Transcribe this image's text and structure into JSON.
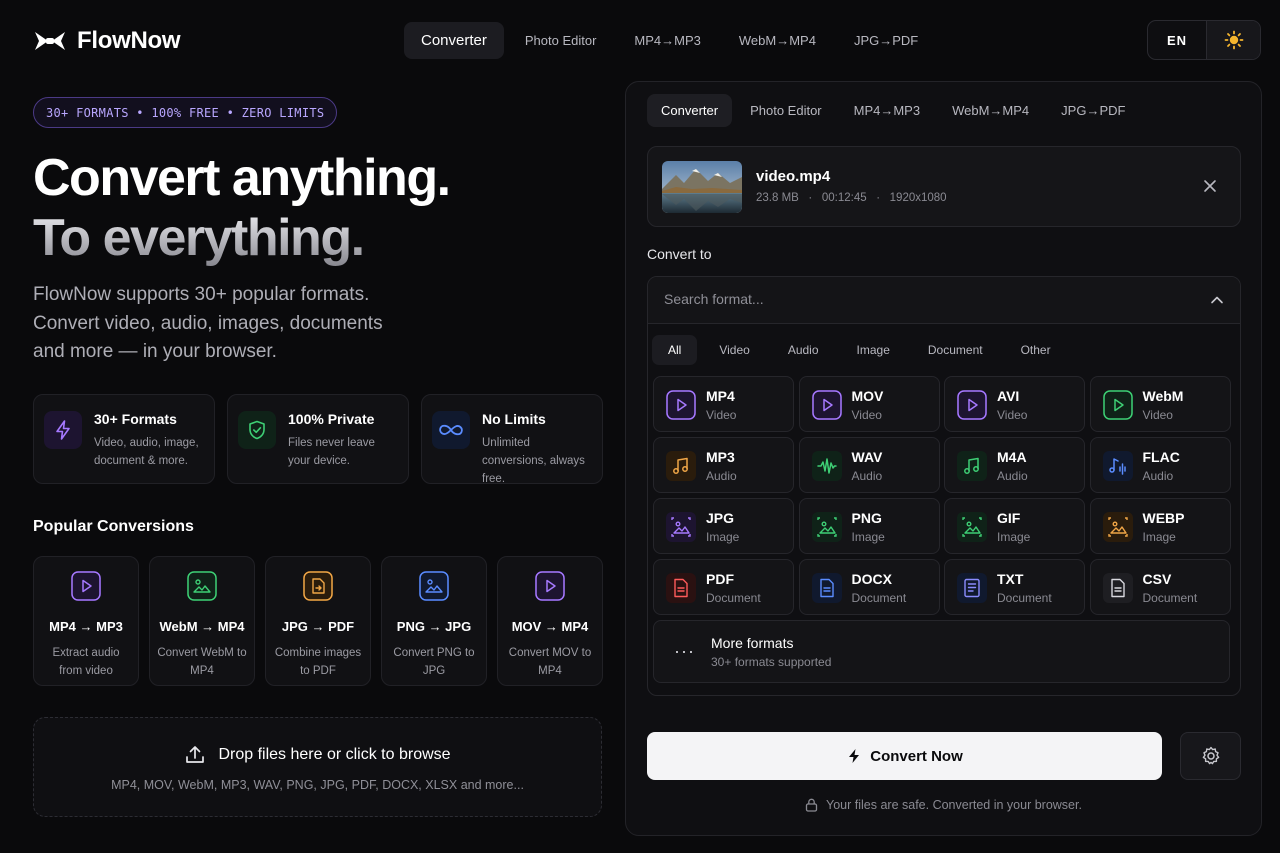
{
  "header": {
    "brand": "FlowNow",
    "nav": [
      "Converter",
      "Photo Editor",
      "MP4→MP3",
      "WebM→MP4",
      "JPG→PDF"
    ],
    "lang": "EN",
    "theme_icon": "sun-icon"
  },
  "hero": {
    "badge": "30+ FORMATS • 100% FREE • ZERO LIMITS",
    "line1": "Convert anything.",
    "line2": "To everything.",
    "description": "FlowNow supports 30+ popular formats. Convert video, audio, images, documents and more — in your browser."
  },
  "features": [
    {
      "title": "30+ Formats",
      "text": "Video, audio, image, document & more.",
      "icon": "lightning-icon"
    },
    {
      "title": "100% Private",
      "text": "Files never leave your device.",
      "icon": "shield-check-icon"
    },
    {
      "title": "No Limits",
      "text": "Unlimited conversions, always free.",
      "icon": "infinity-icon"
    }
  ],
  "popular": {
    "title": "Popular Conversions",
    "items": [
      {
        "title": "MP4 → MP3",
        "text": "Extract audio from video",
        "icon": "play-icon"
      },
      {
        "title": "WebM → MP4",
        "text": "Convert WebM to MP4",
        "icon": "image-icon"
      },
      {
        "title": "JPG → PDF",
        "text": "Combine images to PDF",
        "icon": "file-convert-icon"
      },
      {
        "title": "PNG → JPG",
        "text": "Convert PNG to JPG",
        "icon": "image-icon"
      },
      {
        "title": "MOV → MP4",
        "text": "Convert MOV to MP4",
        "icon": "play-icon"
      }
    ]
  },
  "dropzone": {
    "title": "Drop files here or click to browse",
    "formats": "MP4, MOV, WebM, MP3, WAV, PNG, JPG, PDF, DOCX, XLSX and more..."
  },
  "panel": {
    "tabs": [
      "Converter",
      "Photo Editor",
      "MP4→MP3",
      "WebM→MP4",
      "JPG→PDF"
    ],
    "file": {
      "name": "video.mp4",
      "size": "23.8 MB",
      "duration": "00:12:45",
      "resolution": "1920x1080"
    },
    "convert_to_label": "Convert to",
    "search_placeholder": "Search format...",
    "categories": [
      "All",
      "Video",
      "Audio",
      "Image",
      "Document",
      "Other"
    ],
    "formats": [
      {
        "name": "MP4",
        "kind": "Video",
        "color": "#a679ff"
      },
      {
        "name": "MOV",
        "kind": "Video",
        "color": "#a679ff"
      },
      {
        "name": "AVI",
        "kind": "Video",
        "color": "#a679ff"
      },
      {
        "name": "WebM",
        "kind": "Video",
        "color": "#3ecf75"
      },
      {
        "name": "MP3",
        "kind": "Audio",
        "color": "#f0a647"
      },
      {
        "name": "WAV",
        "kind": "Audio",
        "color": "#3ecf75"
      },
      {
        "name": "M4A",
        "kind": "Audio",
        "color": "#3ecf75"
      },
      {
        "name": "FLAC",
        "kind": "Audio",
        "color": "#5a8cff"
      },
      {
        "name": "JPG",
        "kind": "Image",
        "color": "#a679ff"
      },
      {
        "name": "PNG",
        "kind": "Image",
        "color": "#3ecf75"
      },
      {
        "name": "GIF",
        "kind": "Image",
        "color": "#3ecf75"
      },
      {
        "name": "WEBP",
        "kind": "Image",
        "color": "#f0a647"
      },
      {
        "name": "PDF",
        "kind": "Document",
        "color": "#ff5a5a"
      },
      {
        "name": "DOCX",
        "kind": "Document",
        "color": "#5a8cff"
      },
      {
        "name": "TXT",
        "kind": "Document",
        "color": "#8a8cff"
      },
      {
        "name": "CSV",
        "kind": "Document",
        "color": "#d8d8de"
      }
    ],
    "more": {
      "title": "More formats",
      "text": "30+ formats supported"
    },
    "convert_button": "Convert Now",
    "safe_note": "Your files are safe. Converted in your browser."
  },
  "colors": {
    "accent": "#a679ff",
    "green": "#3ecf75",
    "amber": "#f0a647",
    "blue": "#5a8cff",
    "red": "#ff5a5a"
  }
}
